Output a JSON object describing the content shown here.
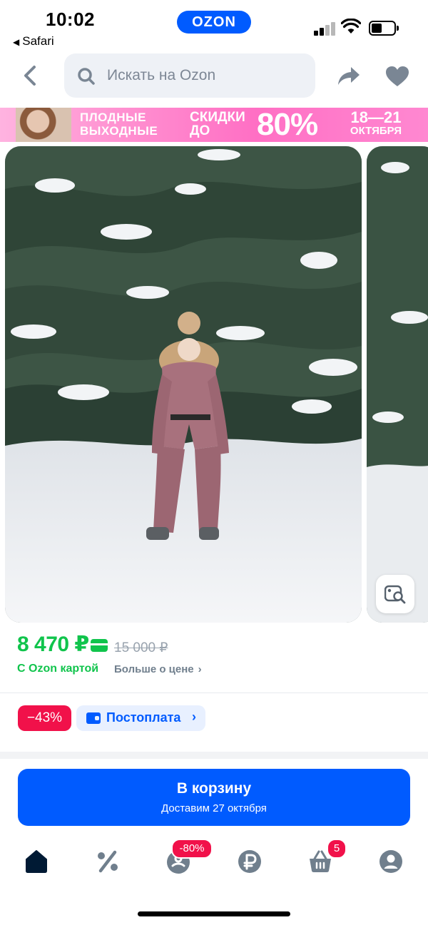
{
  "status_bar": {
    "time": "10:02",
    "back_app": "Safari",
    "brand": "OZON"
  },
  "search": {
    "placeholder": "Искать на Ozon"
  },
  "banner": {
    "line1": "ПЛОДНЫЕ ВЫХОДНЫЕ",
    "line2": "СКИДКИ ДО",
    "percent": "80%",
    "dates": "18—21",
    "month": "ОКТЯБРЯ"
  },
  "price": {
    "current": "8 470 ₽",
    "old": "15 000 ₽",
    "with_card": "С Ozon картой",
    "more": "Больше о цене"
  },
  "badges": {
    "discount": "−43%",
    "postpay": "Постоплата"
  },
  "cart_button": {
    "label": "В корзину",
    "delivery": "Доставим 27 октября"
  },
  "tabbar": {
    "items": [
      {
        "icon": "home-icon",
        "active": true
      },
      {
        "icon": "percent-icon",
        "active": false
      },
      {
        "icon": "fresh-icon",
        "badge": "-80%"
      },
      {
        "icon": "ruble-icon",
        "active": false
      },
      {
        "icon": "basket-icon",
        "badge": "5"
      },
      {
        "icon": "profile-icon",
        "active": false
      }
    ]
  },
  "colors": {
    "accent": "#005bff",
    "price_green": "#10c44c",
    "discount_red": "#f1114a"
  }
}
